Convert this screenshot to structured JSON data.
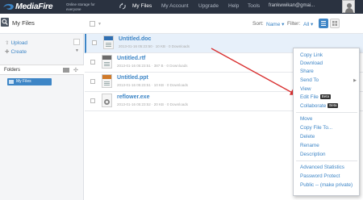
{
  "header": {
    "logo_text": "MediaFire",
    "tagline": "Online storage for everyone",
    "nav": [
      "My Files",
      "My Account",
      "Upgrade",
      "Help",
      "Tools"
    ],
    "user": "frankwwikan@gmai..."
  },
  "toolbar": {
    "title": "My Files",
    "sort_label": "Sort:",
    "sort_value": "Name ▾",
    "filter_label": "Filter:",
    "filter_value": "All ▾"
  },
  "sidebar": {
    "upload": "Upload",
    "create": "Create",
    "folders_tab": "Folders",
    "tree_root": "My Files"
  },
  "files": [
    {
      "name": "Untitled.doc",
      "meta": "2013-01-16 05:23:50 · 10 KB · 0 Downloads"
    },
    {
      "name": "Untitled.rtf",
      "meta": "2013-01-16 05:23:51 · 387 B · 0 Downloads"
    },
    {
      "name": "Untitled.ppt",
      "meta": "2013-01-16 05:23:51 · 10 KB · 0 Downloads"
    },
    {
      "name": "reflower.exe",
      "meta": "2013-01-16 05:23:52 · 20 KB · 0 Downloads"
    }
  ],
  "context_menu": {
    "copy_link": "Copy Link",
    "download": "Download",
    "share": "Share",
    "send_to": "Send To",
    "view": "View",
    "edit_file": "Edit File",
    "collaborate": "Collaborate",
    "beta": "Beta",
    "move": "Move",
    "copy_file_to": "Copy File To...",
    "delete": "Delete",
    "rename": "Rename",
    "description": "Description",
    "advanced_statistics": "Advanced Statistics",
    "password_protect": "Password Protect",
    "public": "Public -- (make private)"
  },
  "colors": {
    "topbar": "#2a3240",
    "accent": "#3d85c6",
    "arrow": "#d93030",
    "doc_icon": "#2f6fb3",
    "rtf_icon": "#6b6b6b",
    "ppt_icon": "#d07a2a",
    "exe_icon": "#888888"
  }
}
